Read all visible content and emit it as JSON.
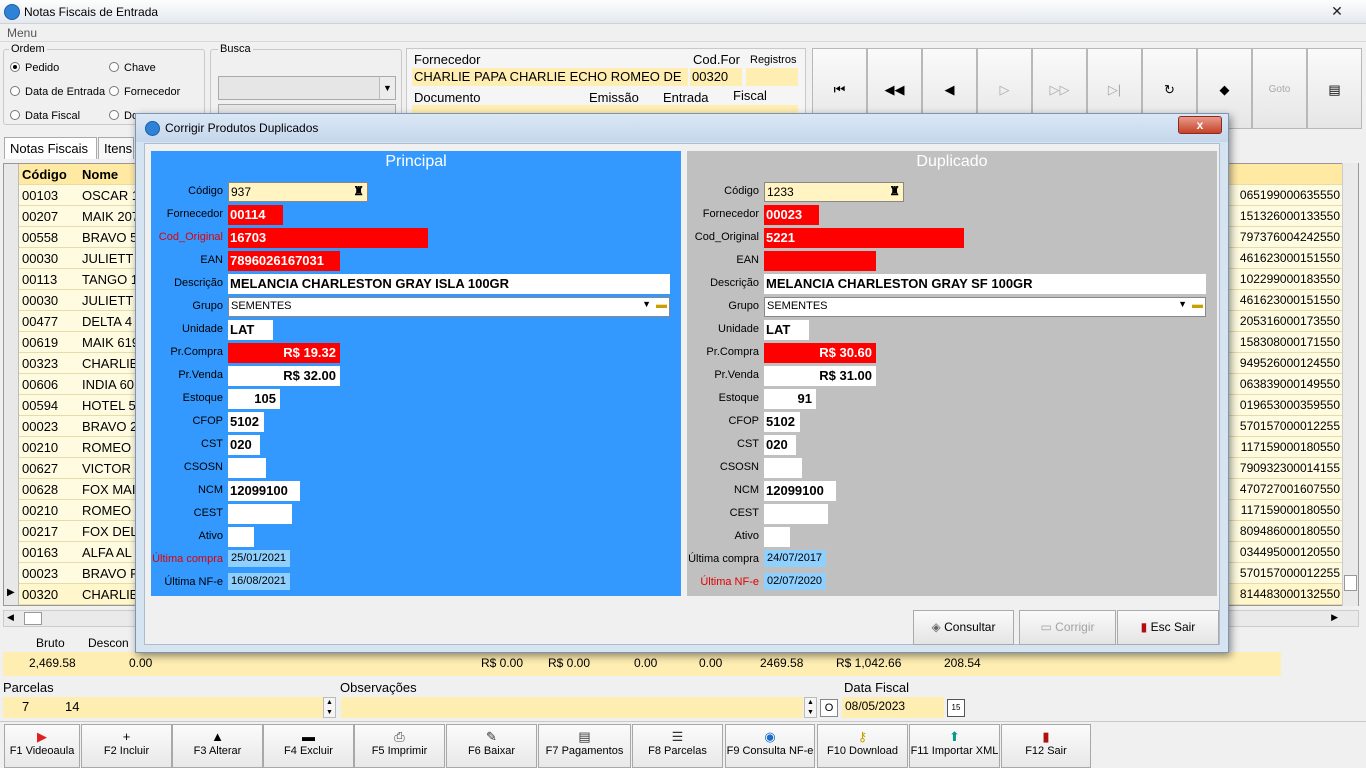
{
  "window": {
    "title": "Notas Fiscais de Entrada",
    "close_label": "✕",
    "menu_label": "Menu"
  },
  "ordem": {
    "label": "Ordem",
    "options": [
      {
        "label": "Pedido",
        "selected": true
      },
      {
        "label": "Chave",
        "selected": false
      },
      {
        "label": "Data de Entrada",
        "selected": false
      },
      {
        "label": "Fornecedor",
        "selected": false
      },
      {
        "label": "Data Fiscal",
        "selected": false
      },
      {
        "label": "Do",
        "selected": false
      }
    ]
  },
  "busca": {
    "label": "Busca"
  },
  "header": {
    "fornecedor_label": "Fornecedor",
    "fornecedor_value": "CHARLIE PAPA CHARLIE ECHO ROMEO DE",
    "codfor_label": "Cod.For",
    "codfor_value": "00320",
    "registros_label": "Registros",
    "documento_label": "Documento",
    "emissao_label": "Emissão",
    "entrada_label": "Entrada",
    "fiscal_label": "Fiscal"
  },
  "nav_buttons": [
    {
      "name": "first-record-button",
      "glyph": "⏮",
      "enabled": true
    },
    {
      "name": "prev-page-button",
      "glyph": "◀◀",
      "enabled": true
    },
    {
      "name": "prev-record-button",
      "glyph": "◀",
      "enabled": true
    },
    {
      "name": "next-record-button",
      "glyph": "▷",
      "enabled": false
    },
    {
      "name": "next-page-button",
      "glyph": "▷▷",
      "enabled": false
    },
    {
      "name": "last-record-button",
      "glyph": "▷|",
      "enabled": false
    },
    {
      "name": "refresh-button",
      "glyph": "↻",
      "enabled": true
    },
    {
      "name": "tag-button",
      "glyph": "◆",
      "enabled": true
    },
    {
      "name": "goto-button",
      "glyph": "Goto",
      "enabled": false
    },
    {
      "name": "layout-button",
      "glyph": "▤",
      "enabled": true
    }
  ],
  "tabs": [
    {
      "label": "Notas Fiscais"
    },
    {
      "label": "Itens"
    }
  ],
  "grid": {
    "columns": [
      "Código",
      "Nome"
    ],
    "rows": [
      {
        "codigo": "00103",
        "nome": "OSCAR 1",
        "chave": "065199000635550"
      },
      {
        "codigo": "00207",
        "nome": "MAIK 207",
        "chave": "151326000133550"
      },
      {
        "codigo": "00558",
        "nome": "BRAVO 5",
        "chave": "797376004242550"
      },
      {
        "codigo": "00030",
        "nome": "JULIETT",
        "chave": "461623000151550"
      },
      {
        "codigo": "00113",
        "nome": "TANGO 1",
        "chave": "102299000183550"
      },
      {
        "codigo": "00030",
        "nome": "JULIETT",
        "chave": "461623000151550"
      },
      {
        "codigo": "00477",
        "nome": "DELTA 4",
        "chave": "205316000173550"
      },
      {
        "codigo": "00619",
        "nome": "MAIK 619",
        "chave": "158308000171550"
      },
      {
        "codigo": "00323",
        "nome": "CHARLIE",
        "chave": "949526000124550"
      },
      {
        "codigo": "00606",
        "nome": "INDIA 60",
        "chave": "063839000149550"
      },
      {
        "codigo": "00594",
        "nome": "HOTEL 5",
        "chave": "019653000359550"
      },
      {
        "codigo": "00023",
        "nome": "BRAVO 2",
        "chave": "570157000012255"
      },
      {
        "codigo": "00210",
        "nome": "ROMEO",
        "chave": "117159000180550"
      },
      {
        "codigo": "00627",
        "nome": "VICTOR",
        "chave": "790932300014155"
      },
      {
        "codigo": "00628",
        "nome": "FOX MAI",
        "chave": "470727001607550"
      },
      {
        "codigo": "00210",
        "nome": "ROMEO",
        "chave": "117159000180550"
      },
      {
        "codigo": "00217",
        "nome": "FOX DEL",
        "chave": "809486000180550"
      },
      {
        "codigo": "00163",
        "nome": "ALFA AL",
        "chave": "034495000120550"
      },
      {
        "codigo": "00023",
        "nome": "BRAVO F",
        "chave": "570157000012255"
      },
      {
        "codigo": "00320",
        "nome": "CHARLIE",
        "chave": "814483000132550"
      }
    ]
  },
  "summary": {
    "bruto_label": "Bruto",
    "desconto_label": "Descon",
    "values": [
      "2,469.58",
      "0.00",
      "R$ 0.00",
      "R$ 0.00",
      "0.00",
      "0.00",
      "2469.58",
      "R$ 1,042.66",
      "208.54"
    ]
  },
  "bottom": {
    "parcelas_label": "Parcelas",
    "parcelas_a": "7",
    "parcelas_b": "14",
    "observacoes_label": "Observações",
    "data_fiscal_label": "Data Fiscal",
    "data_fiscal_value": "08/05/2023",
    "o_label": "O"
  },
  "fkeys": [
    {
      "label": "F1 Videoaula",
      "icon": "▶",
      "color": "#e02020"
    },
    {
      "label": "F2 Incluir",
      "icon": "+",
      "color": "#000000"
    },
    {
      "label": "F3 Alterar",
      "icon": "▲",
      "color": "#000000"
    },
    {
      "label": "F4 Excluir",
      "icon": "▬",
      "color": "#000000"
    },
    {
      "label": "F5 Imprimir",
      "icon": "⎙",
      "color": "#444444"
    },
    {
      "label": "F6 Baixar",
      "icon": "✎",
      "color": "#333333"
    },
    {
      "label": "F7 Pagamentos",
      "icon": "▤",
      "color": "#333333"
    },
    {
      "label": "F8 Parcelas",
      "icon": "☰",
      "color": "#333333"
    },
    {
      "label": "F9 Consulta NF-e",
      "icon": "◉",
      "color": "#1b6fc8"
    },
    {
      "label": "F10 Download",
      "icon": "⚷",
      "color": "#c8a000"
    },
    {
      "label": "F11 Importar XML",
      "icon": "⬆",
      "color": "#0a9a8a"
    },
    {
      "label": "F12 Sair",
      "icon": "▮",
      "color": "#b01010"
    }
  ],
  "modal": {
    "title": "Corrigir Produtos Duplicados",
    "close_label": "x",
    "colors": {
      "principal_bg": "#3399ff",
      "duplicado_bg": "#c0c0c0"
    },
    "principal": {
      "heading": "Principal",
      "codigo": "937",
      "fornecedor": "00114",
      "cod_original": "16703",
      "ean": "7896026167031",
      "descricao": "MELANCIA CHARLESTON GRAY ISLA 100GR",
      "grupo": "SEMENTES",
      "unidade": "LAT",
      "pr_compra": "R$ 19.32",
      "pr_venda": "R$ 32.00",
      "estoque": "105",
      "cfop": "5102",
      "cst": "020",
      "csosn": "",
      "ncm": "12099100",
      "cest": "",
      "ativo": "",
      "ultima_compra": "25/01/2021",
      "ultima_nfe": "16/08/2021"
    },
    "duplicado": {
      "heading": "Duplicado",
      "codigo": "1233",
      "fornecedor": "00023",
      "cod_original": "5221",
      "ean": "",
      "descricao": "MELANCIA CHARLESTON GRAY SF 100GR",
      "grupo": "SEMENTES",
      "unidade": "LAT",
      "pr_compra": "R$ 30.60",
      "pr_venda": "R$ 31.00",
      "estoque": "91",
      "cfop": "5102",
      "cst": "020",
      "csosn": "",
      "ncm": "12099100",
      "cest": "",
      "ativo": "",
      "ultima_compra": "24/07/2017",
      "ultima_nfe": "02/07/2020"
    },
    "labels": {
      "codigo": "Código",
      "fornecedor": "Fornecedor",
      "cod_original": "Cod_Original",
      "ean": "EAN",
      "descricao": "Descrição",
      "grupo": "Grupo",
      "unidade": "Unidade",
      "pr_compra": "Pr.Compra",
      "pr_venda": "Pr.Venda",
      "estoque": "Estoque",
      "cfop": "CFOP",
      "cst": "CST",
      "csosn": "CSOSN",
      "ncm": "NCM",
      "cest": "CEST",
      "ativo": "Ativo",
      "ultima_compra": "Última compra",
      "ultima_nfe": "Última NF-e"
    },
    "buttons": {
      "consultar": "Consultar",
      "corrigir": "Corrigir",
      "sair": "Esc Sair"
    }
  }
}
